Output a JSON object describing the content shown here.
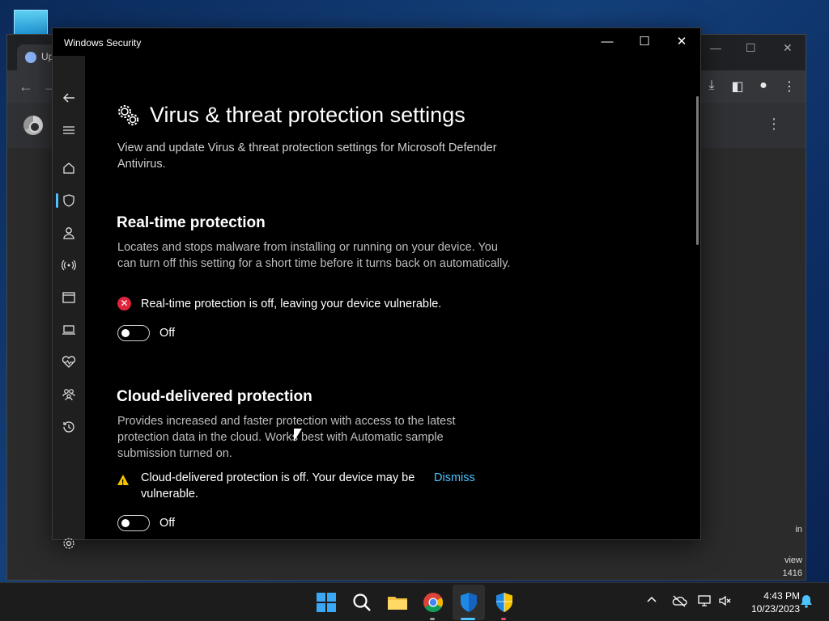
{
  "background_app": {
    "tab_label": "Up",
    "side_texts": [
      "in",
      "view",
      "1416"
    ]
  },
  "window": {
    "title": "Windows Security",
    "controls": {
      "minimize": "—",
      "maximize": "☐",
      "close": "✕"
    }
  },
  "nav": {
    "items": [
      {
        "name": "back",
        "icon": "back-arrow-icon"
      },
      {
        "name": "menu",
        "icon": "hamburger-icon"
      },
      {
        "name": "home",
        "icon": "home-icon"
      },
      {
        "name": "virus-protection",
        "icon": "shield-icon",
        "selected": true
      },
      {
        "name": "account-protection",
        "icon": "person-icon"
      },
      {
        "name": "firewall",
        "icon": "wifi-signal-icon"
      },
      {
        "name": "app-browser-control",
        "icon": "browser-window-icon"
      },
      {
        "name": "device-security",
        "icon": "laptop-icon"
      },
      {
        "name": "device-performance",
        "icon": "heart-pulse-icon"
      },
      {
        "name": "family-options",
        "icon": "family-icon"
      },
      {
        "name": "protection-history",
        "icon": "history-icon"
      },
      {
        "name": "settings",
        "icon": "gear-icon"
      }
    ]
  },
  "page": {
    "title": "Virus & threat protection settings",
    "subtitle": "View and update Virus & threat protection settings for Microsoft Defender Antivirus."
  },
  "realtime": {
    "heading": "Real-time protection",
    "description": "Locates and stops malware from installing or running on your device. You can turn off this setting for a short time before it turns back on automatically.",
    "status": "Real-time protection is off, leaving your device vulnerable.",
    "toggle_state": "Off"
  },
  "cloud": {
    "heading": "Cloud-delivered protection",
    "description": "Provides increased and faster protection with access to the latest protection data in the cloud. Works best with Automatic sample submission turned on.",
    "status": "Cloud-delivered protection is off. Your device may be vulnerable.",
    "dismiss": "Dismiss",
    "toggle_state": "Off"
  },
  "taskbar": {
    "apps": [
      "start-icon",
      "search-icon",
      "file-explorer-icon",
      "chrome-icon",
      "windows-security-icon",
      "uac-shield-icon"
    ],
    "time": "4:43 PM",
    "date": "10/23/2023"
  },
  "colors": {
    "accent": "#4cc2ff",
    "error": "#e0243b",
    "warning": "#f7c500"
  }
}
